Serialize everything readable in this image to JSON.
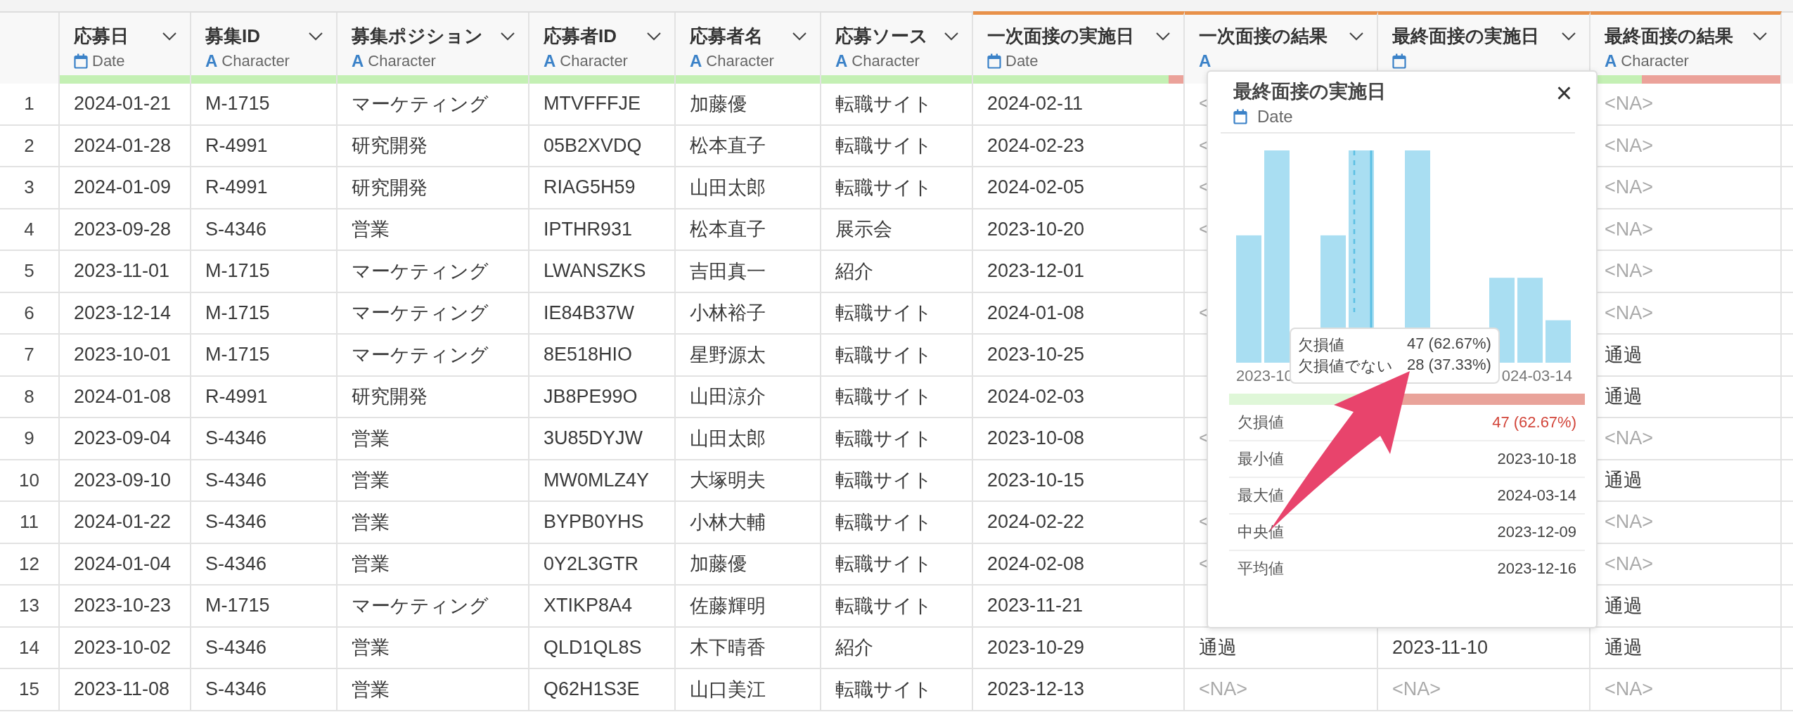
{
  "table": {
    "columns": [
      {
        "name": "応募日",
        "kind": "date",
        "type_label": "Date",
        "level": 1,
        "accent": false
      },
      {
        "name": "募集ID",
        "kind": "character",
        "type_icon": "A",
        "type_label": "Character",
        "level": 1,
        "accent": false
      },
      {
        "name": "募集ポジション",
        "kind": "character",
        "type_icon": "A",
        "type_label": "Character",
        "level": 1,
        "accent": false
      },
      {
        "name": "応募者ID",
        "kind": "character",
        "type_icon": "A",
        "type_label": "Character",
        "level": 1,
        "accent": false
      },
      {
        "name": "応募者名",
        "kind": "character",
        "type_icon": "A",
        "type_label": "Character",
        "level": 1,
        "accent": false
      },
      {
        "name": "応募ソース",
        "kind": "character",
        "type_icon": "A",
        "type_label": "Character",
        "level": 1,
        "accent": false
      },
      {
        "name": "一次面接の実施日",
        "kind": "date",
        "type_label": "Date",
        "level": 0.93,
        "accent": true
      },
      {
        "name": "一次面接の結果",
        "kind": "character",
        "type_icon": "A",
        "accent": true
      },
      {
        "name": "最終面接の実施日",
        "kind": "date",
        "accent": true
      },
      {
        "name": "最終面接の結果",
        "kind": "character",
        "type_icon": "A",
        "type_label": "Character",
        "level": 0.27,
        "accent": true
      }
    ],
    "rows": [
      {
        "num": "1",
        "cells": [
          "2024-01-21",
          "M-1715",
          "マーケティング",
          "MTVFFFJE",
          "加藤優",
          "転職サイト",
          "2024-02-11",
          {
            "text": "<",
            "missing": true
          },
          null,
          {
            "text": "<NA>",
            "missing": true
          }
        ]
      },
      {
        "num": "2",
        "cells": [
          "2024-01-28",
          "R-4991",
          "研究開発",
          "05B2XVDQ",
          "松本直子",
          "転職サイト",
          "2024-02-23",
          {
            "text": "<",
            "missing": true
          },
          null,
          {
            "text": "<NA>",
            "missing": true
          }
        ]
      },
      {
        "num": "3",
        "cells": [
          "2024-01-09",
          "R-4991",
          "研究開発",
          "RIAG5H59",
          "山田太郎",
          "転職サイト",
          "2024-02-05",
          {
            "text": "<",
            "missing": true
          },
          null,
          {
            "text": "<NA>",
            "missing": true
          }
        ]
      },
      {
        "num": "4",
        "cells": [
          "2023-09-28",
          "S-4346",
          "営業",
          "IPTHR931",
          "松本直子",
          "展示会",
          "2023-10-20",
          {
            "text": "<",
            "missing": true
          },
          null,
          {
            "text": "<NA>",
            "missing": true
          }
        ]
      },
      {
        "num": "5",
        "cells": [
          "2023-11-01",
          "M-1715",
          "マーケティング",
          "LWANSZKS",
          "吉田真一",
          "紹介",
          "2023-12-01",
          null,
          null,
          {
            "text": "<NA>",
            "missing": true
          }
        ]
      },
      {
        "num": "6",
        "cells": [
          "2023-12-14",
          "M-1715",
          "マーケティング",
          "IE84B37W",
          "小林裕子",
          "転職サイト",
          "2024-01-08",
          {
            "text": "<",
            "missing": true
          },
          null,
          {
            "text": "<NA>",
            "missing": true
          }
        ]
      },
      {
        "num": "7",
        "cells": [
          "2023-10-01",
          "M-1715",
          "マーケティング",
          "8E518HIO",
          "星野源太",
          "転職サイト",
          "2023-10-25",
          null,
          null,
          "通過"
        ]
      },
      {
        "num": "8",
        "cells": [
          "2024-01-08",
          "R-4991",
          "研究開発",
          "JB8PE99O",
          "山田涼介",
          "転職サイト",
          "2024-02-03",
          null,
          null,
          "通過"
        ]
      },
      {
        "num": "9",
        "cells": [
          "2023-09-04",
          "S-4346",
          "営業",
          "3U85DYJW",
          "山田太郎",
          "転職サイト",
          "2023-10-08",
          {
            "text": "<",
            "missing": true
          },
          null,
          {
            "text": "<NA>",
            "missing": true
          }
        ]
      },
      {
        "num": "10",
        "cells": [
          "2023-09-10",
          "S-4346",
          "営業",
          "MW0MLZ4Y",
          "大塚明夫",
          "転職サイト",
          "2023-10-15",
          null,
          null,
          "通過"
        ]
      },
      {
        "num": "11",
        "cells": [
          "2024-01-22",
          "S-4346",
          "営業",
          "BYPB0YHS",
          "小林大輔",
          "転職サイト",
          "2024-02-22",
          {
            "text": "<",
            "missing": true
          },
          null,
          {
            "text": "<NA>",
            "missing": true
          }
        ]
      },
      {
        "num": "12",
        "cells": [
          "2024-01-04",
          "S-4346",
          "営業",
          "0Y2L3GTR",
          "加藤優",
          "転職サイト",
          "2024-02-08",
          {
            "text": "<",
            "missing": true
          },
          null,
          {
            "text": "<NA>",
            "missing": true
          }
        ]
      },
      {
        "num": "13",
        "cells": [
          "2023-10-23",
          "M-1715",
          "マーケティング",
          "XTIKP8A4",
          "佐藤輝明",
          "転職サイト",
          "2023-11-21",
          null,
          null,
          "通過"
        ]
      },
      {
        "num": "14",
        "cells": [
          "2023-10-02",
          "S-4346",
          "営業",
          "QLD1QL8S",
          "木下晴香",
          "紹介",
          "2023-10-29",
          "通過",
          "2023-11-10",
          "通過"
        ]
      },
      {
        "num": "15",
        "cells": [
          "2023-11-08",
          "S-4346",
          "営業",
          "Q62H1S3E",
          "山口美江",
          "転職サイト",
          "2023-12-13",
          {
            "text": "<NA>",
            "missing": true
          },
          {
            "text": "<NA>",
            "missing": true
          },
          {
            "text": "<NA>",
            "missing": true
          }
        ]
      }
    ]
  },
  "popup": {
    "title": "最終面接の実施日",
    "kind": "date",
    "type_label": "Date",
    "close": "×",
    "axis_labels": [
      "2023-10",
      "024-03-14"
    ],
    "tooltip": [
      {
        "label": "欠損値",
        "value": "47 (62.67%)"
      },
      {
        "label": "欠損値でない",
        "value": "28 (37.33%)"
      }
    ],
    "level": 0.3733,
    "stats": [
      {
        "label": "欠損値",
        "value": "47 (62.67%)",
        "alert": true
      },
      {
        "label": "最小値",
        "value": "2023-10-18",
        "alert": false
      },
      {
        "label": "最大値",
        "value": "2024-03-14",
        "alert": false
      },
      {
        "label": "中央値",
        "value": "2023-12-09",
        "alert": false
      },
      {
        "label": "平均値",
        "value": "2023-12-16",
        "alert": false
      }
    ]
  }
}
